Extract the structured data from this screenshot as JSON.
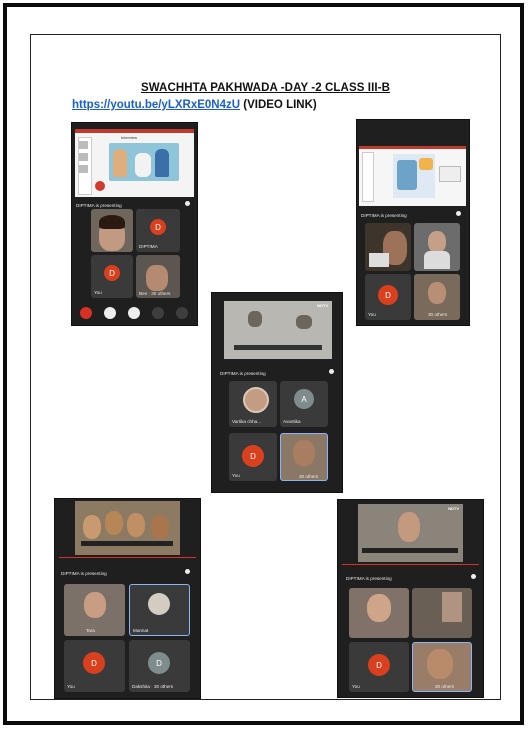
{
  "heading": "SWACHHTA PAKHWADA -DAY -2 CLASS III-B",
  "link": {
    "url_text": "https://youtu.be/yLXRxE0N4zU",
    "suffix": " (VIDEO LINK)"
  },
  "shots": [
    {
      "presenting": "DIPTIMA is presenting",
      "slide_title": "Interview",
      "tiles": [
        {
          "label": "",
          "kind": "photo"
        },
        {
          "label": "DIPTIMA",
          "kind": "avatar",
          "letter": "D"
        },
        {
          "label": "You",
          "kind": "avatar",
          "letter": "D"
        },
        {
          "label": "Ben · 30 others",
          "kind": "photo"
        }
      ]
    },
    {
      "presenting": "DIPTIMA is presenting",
      "tiles": [
        {
          "label": "",
          "kind": "photo"
        },
        {
          "label": "",
          "kind": "photo"
        },
        {
          "label": "You",
          "kind": "avatar",
          "letter": "D"
        },
        {
          "label": "30 others",
          "kind": "photo"
        }
      ]
    },
    {
      "presenting": "DIPTIMA is presenting",
      "video_logo": "NDTV",
      "tiles": [
        {
          "label": "Vartika chha...",
          "kind": "photo"
        },
        {
          "label": "Avantika",
          "kind": "avatar",
          "letter": "A"
        },
        {
          "label": "You",
          "kind": "avatar",
          "letter": "D"
        },
        {
          "label": "30 others",
          "kind": "photo"
        }
      ]
    },
    {
      "presenting": "DIPTIMA is presenting",
      "tiles": [
        {
          "label": "Tara",
          "kind": "photo"
        },
        {
          "label": "Mannat",
          "kind": "photo"
        },
        {
          "label": "You",
          "kind": "avatar",
          "letter": "D"
        },
        {
          "label": "Dakshita · 30 others",
          "kind": "avatar",
          "letter": "D"
        }
      ]
    },
    {
      "presenting": "DIPTIMA is presenting",
      "video_logo": "NDTV",
      "tiles": [
        {
          "label": "",
          "kind": "photo"
        },
        {
          "label": "",
          "kind": "photo"
        },
        {
          "label": "You",
          "kind": "avatar",
          "letter": "D"
        },
        {
          "label": "30 others",
          "kind": "photo"
        }
      ]
    }
  ],
  "colors": {
    "avatar_red": "#d9401e",
    "avatar_grey": "#7f8c8d",
    "link_blue": "#1a5fc9",
    "end_call": "#d93025"
  }
}
